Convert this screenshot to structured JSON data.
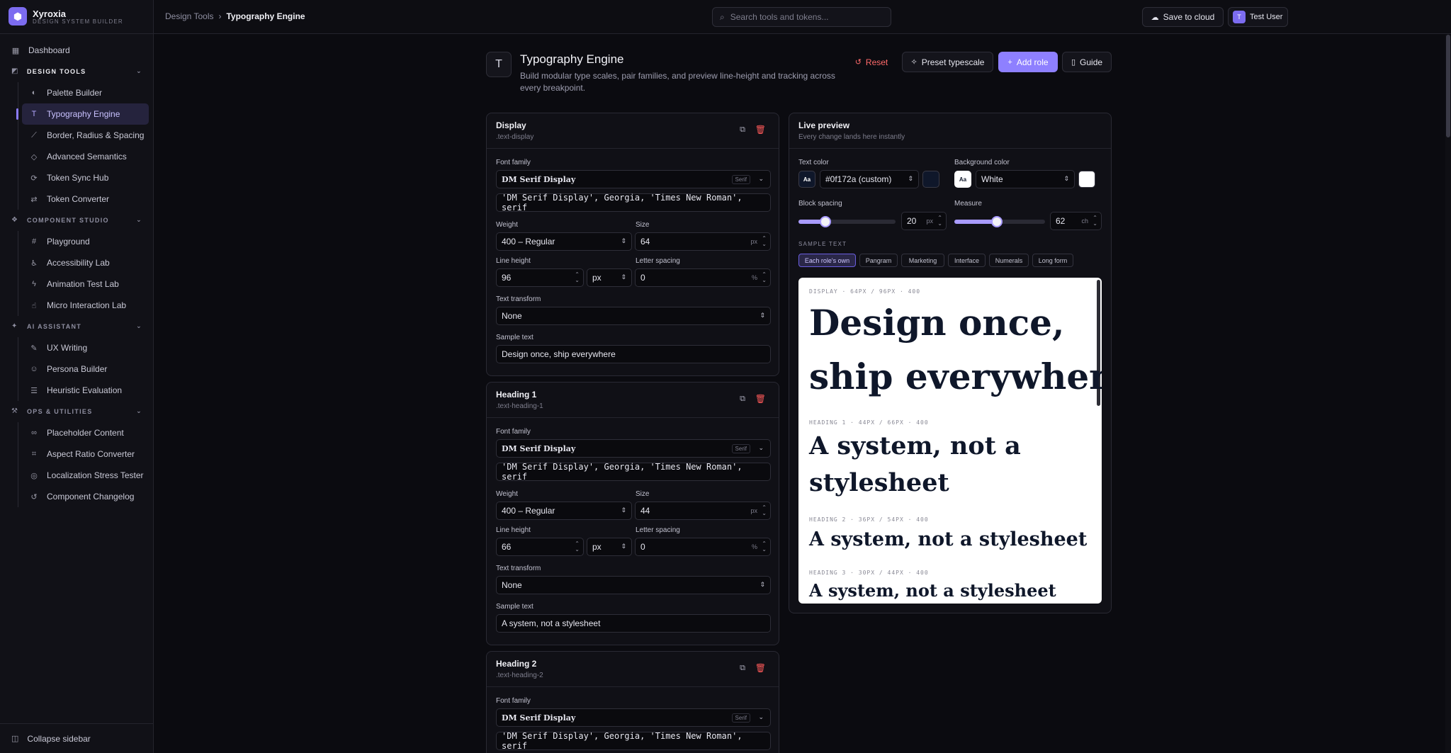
{
  "brand": {
    "name": "Xyroxia",
    "subtitle": "DESIGN SYSTEM BUILDER"
  },
  "topbar": {
    "breadcrumb": [
      "Design Tools",
      "Typography Engine"
    ],
    "search_placeholder": "Search tools and tokens...",
    "save_label": "Save to cloud",
    "user_initial": "T",
    "user_name": "Test User"
  },
  "sidebar": {
    "dashboard": "Dashboard",
    "sections": [
      {
        "title": "DESIGN TOOLS",
        "items": [
          "Palette Builder",
          "Typography Engine",
          "Border, Radius & Spacing",
          "Advanced Semantics",
          "Token Sync Hub",
          "Token Converter"
        ]
      },
      {
        "title": "COMPONENT STUDIO",
        "items": [
          "Playground",
          "Accessibility Lab",
          "Animation Test Lab",
          "Micro Interaction Lab"
        ]
      },
      {
        "title": "AI ASSISTANT",
        "items": [
          "UX Writing",
          "Persona Builder",
          "Heuristic Evaluation"
        ]
      },
      {
        "title": "OPS & UTILITIES",
        "items": [
          "Placeholder Content",
          "Aspect Ratio Converter",
          "Localization Stress Tester",
          "Component Changelog"
        ]
      }
    ],
    "active_item": "Typography Engine",
    "collapse_label": "Collapse sidebar"
  },
  "page": {
    "title": "Typography Engine",
    "description": "Build modular type scales, pair families, and preview line-height and tracking across every breakpoint.",
    "actions": {
      "reset": "Reset",
      "preset": "Preset typescale",
      "add": "Add role",
      "guide": "Guide"
    }
  },
  "labels": {
    "font_family": "Font family",
    "weight": "Weight",
    "size": "Size",
    "line_height": "Line height",
    "letter_spacing": "Letter spacing",
    "text_transform": "Text transform",
    "sample_text": "Sample text",
    "serif_badge": "Serif",
    "px": "px",
    "pct": "%"
  },
  "roles": [
    {
      "name": "Display",
      "class": ".text-display",
      "family": "DM Serif Display",
      "stack": "'DM Serif Display', Georgia, 'Times New Roman', serif",
      "weight": "400 – Regular",
      "size": "64",
      "line_height": "96",
      "line_unit": "px",
      "letter_spacing": "0",
      "transform": "None",
      "sample": "Design once, ship everywhere"
    },
    {
      "name": "Heading 1",
      "class": ".text-heading-1",
      "family": "DM Serif Display",
      "stack": "'DM Serif Display', Georgia, 'Times New Roman', serif",
      "weight": "400 – Regular",
      "size": "44",
      "line_height": "66",
      "line_unit": "px",
      "letter_spacing": "0",
      "transform": "None",
      "sample": "A system, not a stylesheet"
    },
    {
      "name": "Heading 2",
      "class": ".text-heading-2",
      "family": "DM Serif Display",
      "stack": "'DM Serif Display', Georgia, 'Times New Roman', serif"
    }
  ],
  "preview": {
    "title": "Live preview",
    "subtitle": "Every change lands here instantly",
    "text_color_label": "Text color",
    "text_color_value": "#0f172a (custom)",
    "text_color_hex": "#0f172a",
    "bg_color_label": "Background color",
    "bg_color_value": "White",
    "bg_color_hex": "#ffffff",
    "swatch_glyph": "Aa",
    "block_spacing_label": "Block spacing",
    "block_spacing_value": "20",
    "block_spacing_unit": "px",
    "block_spacing_fraction": 0.28,
    "measure_label": "Measure",
    "measure_value": "62",
    "measure_unit": "ch",
    "measure_fraction": 0.47,
    "sample_text_label": "SAMPLE TEXT",
    "chips": [
      "Each role's own",
      "Pangram",
      "Marketing",
      "Interface",
      "Numerals",
      "Long form"
    ],
    "active_chip": "Each role's own",
    "samples": [
      {
        "meta": "DISPLAY · 64PX / 96PX · 400",
        "lines": [
          "Design once,",
          "ship everywhere"
        ]
      },
      {
        "meta": "HEADING 1 · 44PX / 66PX · 400",
        "lines": [
          "A system, not a",
          "stylesheet"
        ]
      },
      {
        "meta": "HEADING 2 · 36PX / 54PX · 400",
        "lines": [
          "A system, not a stylesheet"
        ]
      },
      {
        "meta": "HEADING 3 · 30PX / 44PX · 400",
        "lines": [
          "A system, not a stylesheet"
        ]
      }
    ]
  }
}
